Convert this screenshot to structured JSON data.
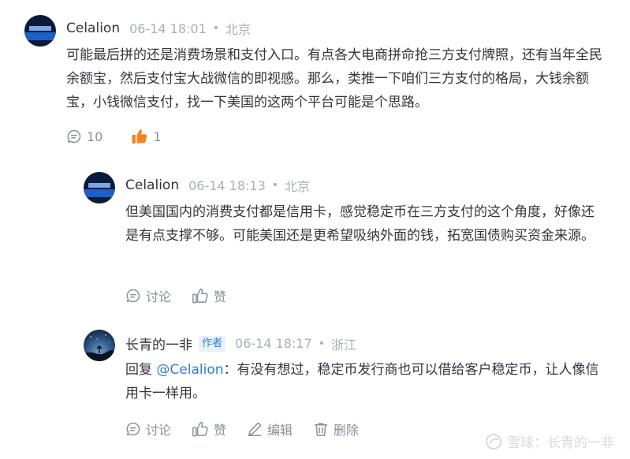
{
  "comments": [
    {
      "author": "Celalion",
      "time": "06-14 18:01",
      "location": "北京",
      "text": "可能最后拼的还是消费场景和支付入口。有点各大电商拼命抢三方支付牌照，还有当年全民余额宝，然后支付宝大战微信的即视感。那么，类推一下咱们三方支付的格局，大钱余额宝，小钱微信支付，找一下美国的这两个平台可能是个思路。",
      "reply_count": "10",
      "like_count": "1"
    },
    {
      "author": "Celalion",
      "time": "06-14 18:13",
      "location": "北京",
      "text": "但美国国内的消费支付都是信用卡，感觉稳定币在三方支付的这个角度，好像还是有点支撑不够。可能美国还是更希望吸纳外面的钱，拓宽国债购买资金来源。",
      "discuss_label": "讨论",
      "like_label": "赞"
    },
    {
      "author": "长青的一非",
      "author_badge": "作者",
      "time": "06-14 18:17",
      "location": "浙江",
      "reply_prefix": "回复",
      "mention": "@Celalion",
      "text": "：有没有想过，稳定币发行商也可以借给客户稳定币，让人像信用卡一样用。",
      "discuss_label": "讨论",
      "like_label": "赞",
      "edit_label": "编辑",
      "delete_label": "删除"
    }
  ],
  "separator": "•",
  "watermark": "雪球：长青的一非",
  "icons": {
    "comment": "speech-bubble-icon",
    "like_active": "thumbs-up-filled-icon",
    "like": "thumbs-up-icon",
    "edit": "pencil-icon",
    "delete": "trash-icon"
  },
  "colors": {
    "like_active": "#f58220",
    "mention": "#2f7fd6",
    "meta": "#a9aeb8"
  }
}
